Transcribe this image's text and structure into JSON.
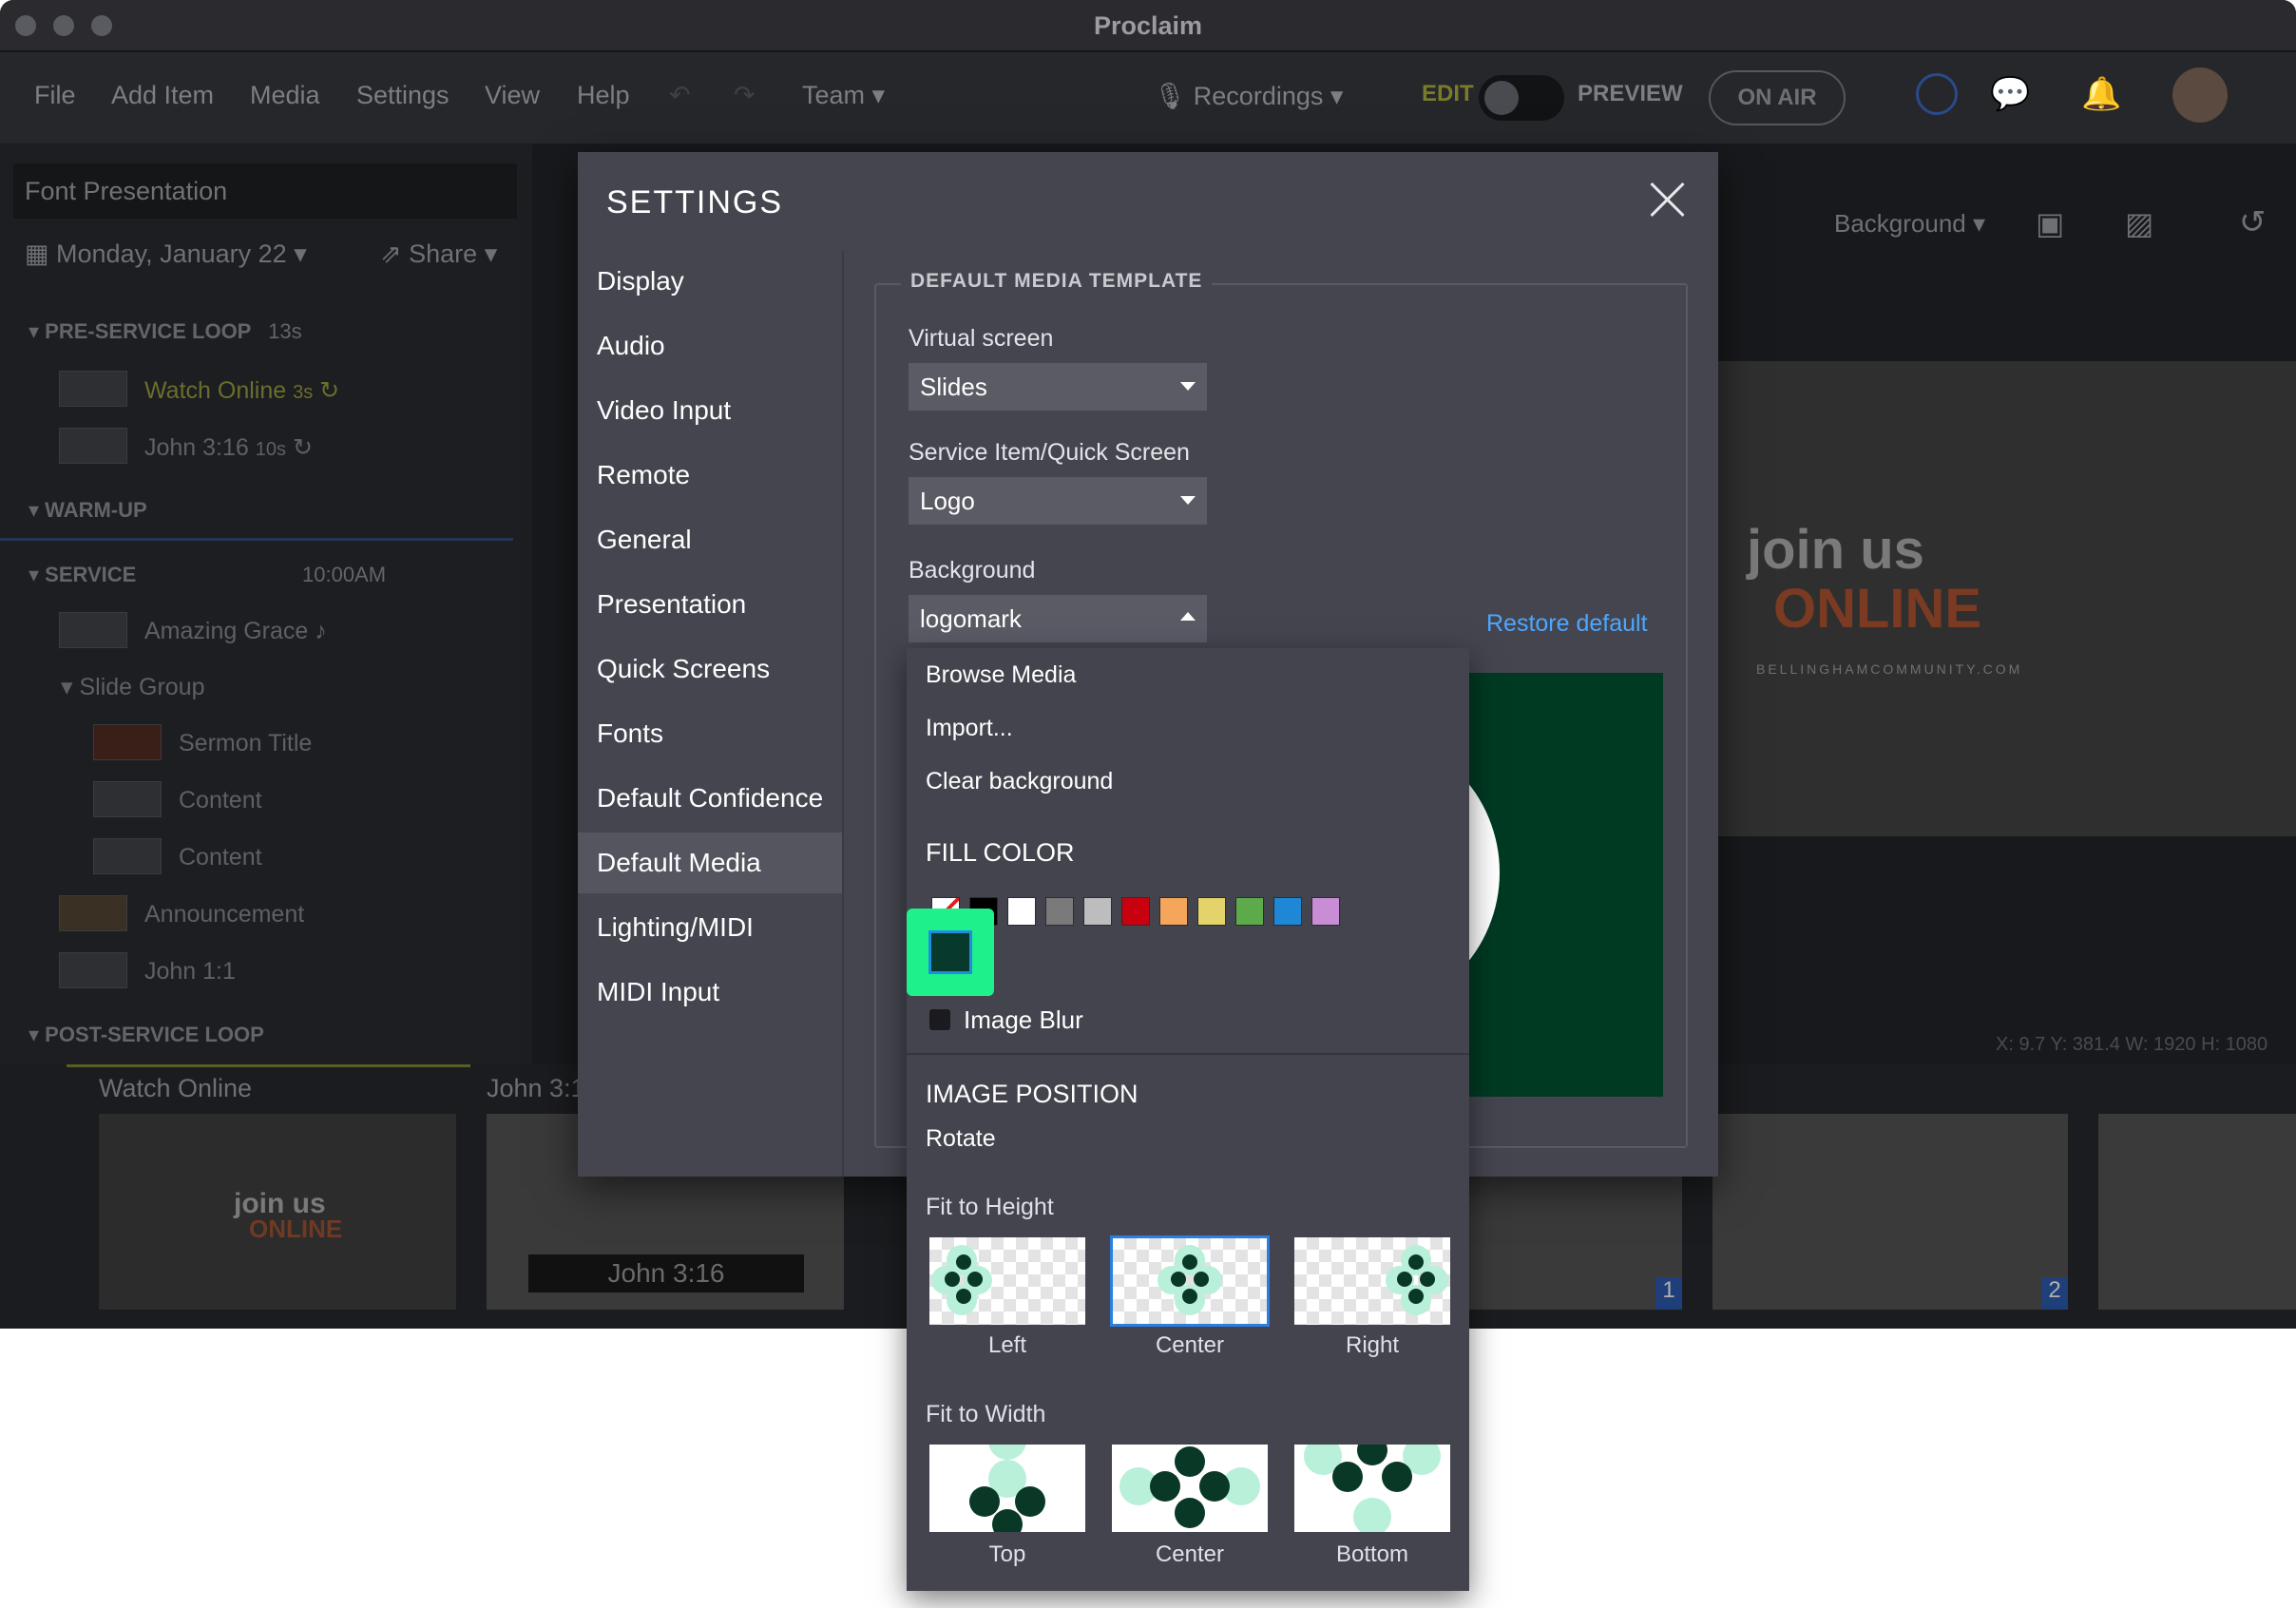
{
  "window": {
    "title": "Proclaim"
  },
  "menubar": {
    "items": [
      "File",
      "Add Item",
      "Media",
      "Settings",
      "View",
      "Help"
    ],
    "team": "Team",
    "recordings": "Recordings",
    "edit": "EDIT",
    "preview": "PREVIEW",
    "on_air": "ON AIR"
  },
  "sidebar": {
    "presentation_title": "Font Presentation",
    "date": "Monday, January 22",
    "share": "Share",
    "sections": [
      {
        "label": "PRE-SERVICE LOOP",
        "meta": "13s"
      },
      {
        "label": "WARM-UP",
        "meta": ""
      },
      {
        "label": "SERVICE",
        "meta": "10:00AM"
      },
      {
        "label": "POST-SERVICE LOOP",
        "meta": ""
      }
    ],
    "items": [
      {
        "label": "Watch Online",
        "meta": "3s"
      },
      {
        "label": "John 3:16",
        "meta": "10s"
      },
      {
        "label": "Amazing Grace",
        "meta": "♪"
      },
      {
        "label": "Slide Group",
        "meta": ""
      },
      {
        "label": "Sermon Title",
        "meta": ""
      },
      {
        "label": "Content",
        "meta": ""
      },
      {
        "label": "Content",
        "meta": ""
      },
      {
        "label": "Announcement",
        "meta": ""
      },
      {
        "label": "John 1:1",
        "meta": ""
      }
    ]
  },
  "editor": {
    "background_menu": "Background",
    "status": "X: 9.7  Y: 381.4   W: 1920  H: 1080",
    "slide_numbers": [
      "1",
      "2"
    ]
  },
  "bottom_strip": {
    "labels": [
      "Watch Online",
      "John 3:1"
    ],
    "thumb_caption": "John 3:16",
    "promo": {
      "line1": "join us",
      "line2": "ONLINE",
      "url": "BELLINGHAMCOMMUNITY.COM"
    }
  },
  "settings": {
    "title": "SETTINGS",
    "nav": [
      "Display",
      "Audio",
      "Video Input",
      "Remote",
      "General",
      "Presentation",
      "Quick Screens",
      "Fonts",
      "Default Confidence",
      "Default Media",
      "Lighting/MIDI",
      "MIDI Input"
    ],
    "active_nav": "Default Media",
    "section_legend": "DEFAULT MEDIA TEMPLATE",
    "virtual_screen": {
      "label": "Virtual screen",
      "value": "Slides"
    },
    "service_item": {
      "label": "Service Item/Quick Screen",
      "value": "Logo"
    },
    "background": {
      "label": "Background",
      "value": "logomark"
    },
    "restore_default": "Restore default"
  },
  "background_menu": {
    "options": [
      "Browse Media",
      "Import...",
      "Clear background"
    ],
    "fill_color_header": "FILL COLOR",
    "swatches": [
      "none",
      "#000000",
      "#ffffff",
      "#7a7a7a",
      "#bdbdbd",
      "#c9000d",
      "#f5a65b",
      "#e3d36a",
      "#5daa4a",
      "#1e88d6",
      "#c98dd6"
    ],
    "custom_color": "#073a2c",
    "image_blur": "Image Blur",
    "image_position_header": "IMAGE POSITION",
    "rotate": "Rotate",
    "fit_to_height": {
      "label": "Fit to Height",
      "options": [
        "Left",
        "Center",
        "Right"
      ],
      "selected": "Center"
    },
    "fit_to_width": {
      "label": "Fit to Width",
      "options": [
        "Top",
        "Center",
        "Bottom"
      ]
    }
  }
}
